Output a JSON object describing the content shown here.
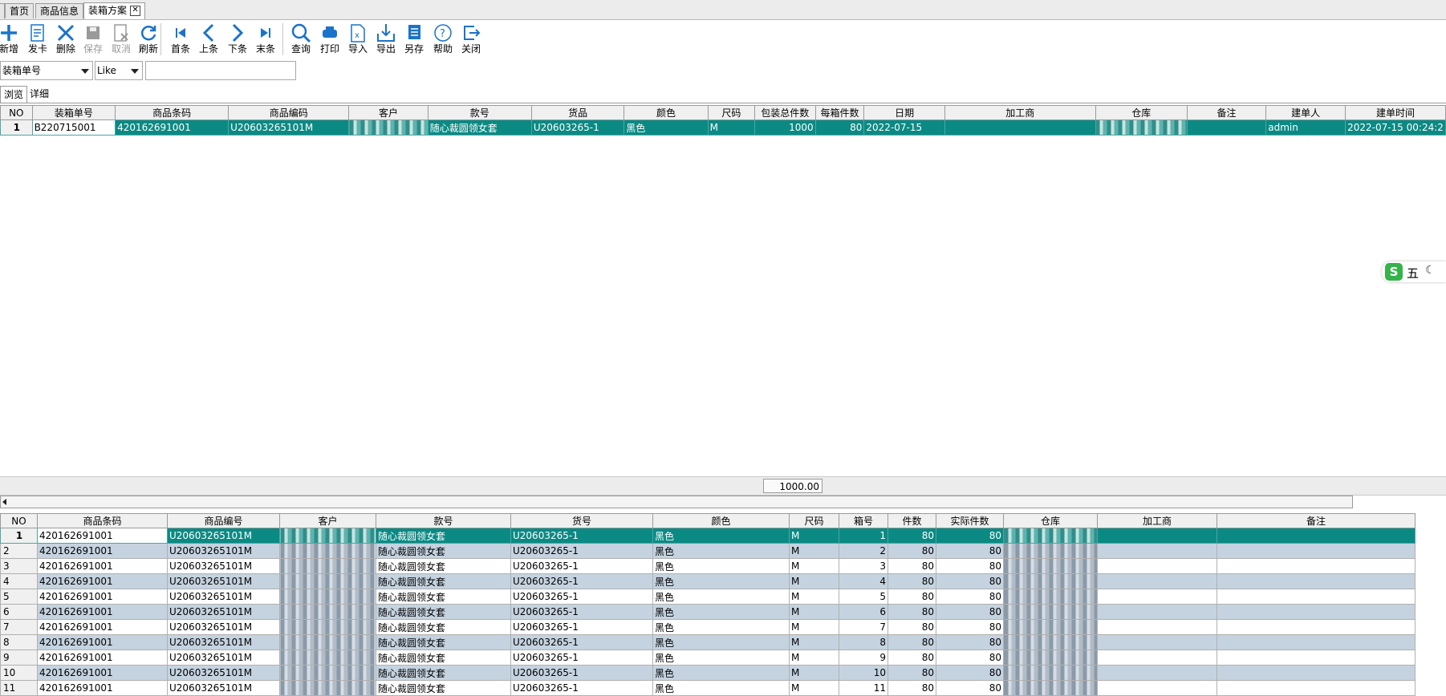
{
  "tabs": [
    {
      "label": "首页",
      "active": false
    },
    {
      "label": "商品信息",
      "active": false
    },
    {
      "label": "装箱方案",
      "active": true
    }
  ],
  "toolbar": [
    {
      "label": "新增",
      "icon": "plus-icon",
      "enabled": true
    },
    {
      "label": "发卡",
      "icon": "card-icon",
      "enabled": true
    },
    {
      "label": "删除",
      "icon": "close-x-icon",
      "enabled": true
    },
    {
      "label": "保存",
      "icon": "save-icon",
      "enabled": false
    },
    {
      "label": "取消",
      "icon": "cancel-icon",
      "enabled": false
    },
    {
      "label": "刷新",
      "icon": "refresh-icon",
      "enabled": true
    },
    {
      "label": "首条",
      "icon": "first-icon",
      "enabled": true
    },
    {
      "label": "上条",
      "icon": "prev-icon",
      "enabled": true
    },
    {
      "label": "下条",
      "icon": "next-icon",
      "enabled": true
    },
    {
      "label": "末条",
      "icon": "last-icon",
      "enabled": true
    },
    {
      "label": "查询",
      "icon": "search-icon",
      "enabled": true
    },
    {
      "label": "打印",
      "icon": "print-icon",
      "enabled": true
    },
    {
      "label": "导入",
      "icon": "import-icon",
      "enabled": true
    },
    {
      "label": "导出",
      "icon": "export-icon",
      "enabled": true
    },
    {
      "label": "另存",
      "icon": "save-as-icon",
      "enabled": true
    },
    {
      "label": "帮助",
      "icon": "help-icon",
      "enabled": true
    },
    {
      "label": "关闭",
      "icon": "exit-icon",
      "enabled": true
    }
  ],
  "filter": {
    "field": "装箱单号",
    "operator": "Like",
    "value": ""
  },
  "subtabs": [
    {
      "label": "浏览",
      "active": true
    },
    {
      "label": "详细",
      "active": false
    }
  ],
  "master": {
    "columns": [
      "NO",
      "装箱单号",
      "商品条码",
      "商品编码",
      "客户",
      "款号",
      "货品",
      "颜色",
      "尺码",
      "包装总件数",
      "每箱件数",
      "日期",
      "加工商",
      "仓库",
      "备注",
      "建单人",
      "建单时间"
    ],
    "rows": [
      {
        "no": "1",
        "box_no": "B220715001",
        "barcode": "420162691001",
        "code": "U20603265101M",
        "customer": "",
        "style": "随心裁圆领女套",
        "item": "U20603265-1",
        "color": "黑色",
        "size": "M",
        "total_qty": "1000",
        "per_box": "80",
        "date": "2022-07-15",
        "processor": "",
        "warehouse": "",
        "remark": "",
        "creator": "admin",
        "created": "2022-07-15 00:24:2"
      }
    ]
  },
  "summary": {
    "total": "1000.00"
  },
  "detail": {
    "columns": [
      "NO",
      "商品条码",
      "商品编号",
      "客户",
      "款号",
      "货号",
      "颜色",
      "尺码",
      "箱号",
      "件数",
      "实际件数",
      "仓库",
      "加工商",
      "备注"
    ],
    "rows": [
      {
        "no": "1",
        "barcode": "420162691001",
        "code": "U20603265101M",
        "style": "随心裁圆领女套",
        "item": "U20603265-1",
        "color": "黑色",
        "size": "M",
        "box": "1",
        "qty": "80",
        "actual": "80"
      },
      {
        "no": "2",
        "barcode": "420162691001",
        "code": "U20603265101M",
        "style": "随心裁圆领女套",
        "item": "U20603265-1",
        "color": "黑色",
        "size": "M",
        "box": "2",
        "qty": "80",
        "actual": "80"
      },
      {
        "no": "3",
        "barcode": "420162691001",
        "code": "U20603265101M",
        "style": "随心裁圆领女套",
        "item": "U20603265-1",
        "color": "黑色",
        "size": "M",
        "box": "3",
        "qty": "80",
        "actual": "80"
      },
      {
        "no": "4",
        "barcode": "420162691001",
        "code": "U20603265101M",
        "style": "随心裁圆领女套",
        "item": "U20603265-1",
        "color": "黑色",
        "size": "M",
        "box": "4",
        "qty": "80",
        "actual": "80"
      },
      {
        "no": "5",
        "barcode": "420162691001",
        "code": "U20603265101M",
        "style": "随心裁圆领女套",
        "item": "U20603265-1",
        "color": "黑色",
        "size": "M",
        "box": "5",
        "qty": "80",
        "actual": "80"
      },
      {
        "no": "6",
        "barcode": "420162691001",
        "code": "U20603265101M",
        "style": "随心裁圆领女套",
        "item": "U20603265-1",
        "color": "黑色",
        "size": "M",
        "box": "6",
        "qty": "80",
        "actual": "80"
      },
      {
        "no": "7",
        "barcode": "420162691001",
        "code": "U20603265101M",
        "style": "随心裁圆领女套",
        "item": "U20603265-1",
        "color": "黑色",
        "size": "M",
        "box": "7",
        "qty": "80",
        "actual": "80"
      },
      {
        "no": "8",
        "barcode": "420162691001",
        "code": "U20603265101M",
        "style": "随心裁圆领女套",
        "item": "U20603265-1",
        "color": "黑色",
        "size": "M",
        "box": "8",
        "qty": "80",
        "actual": "80"
      },
      {
        "no": "9",
        "barcode": "420162691001",
        "code": "U20603265101M",
        "style": "随心裁圆领女套",
        "item": "U20603265-1",
        "color": "黑色",
        "size": "M",
        "box": "9",
        "qty": "80",
        "actual": "80"
      },
      {
        "no": "10",
        "barcode": "420162691001",
        "code": "U20603265101M",
        "style": "随心裁圆领女套",
        "item": "U20603265-1",
        "color": "黑色",
        "size": "M",
        "box": "10",
        "qty": "80",
        "actual": "80"
      },
      {
        "no": "11",
        "barcode": "420162691001",
        "code": "U20603265101M",
        "style": "随心裁圆领女套",
        "item": "U20603265-1",
        "color": "黑色",
        "size": "M",
        "box": "11",
        "qty": "80",
        "actual": "80"
      }
    ]
  },
  "ime": {
    "label": "五"
  },
  "colors": {
    "selection": "#0b8a84",
    "alt_row": "#c5d3e0",
    "accent": "#1a73c9"
  }
}
